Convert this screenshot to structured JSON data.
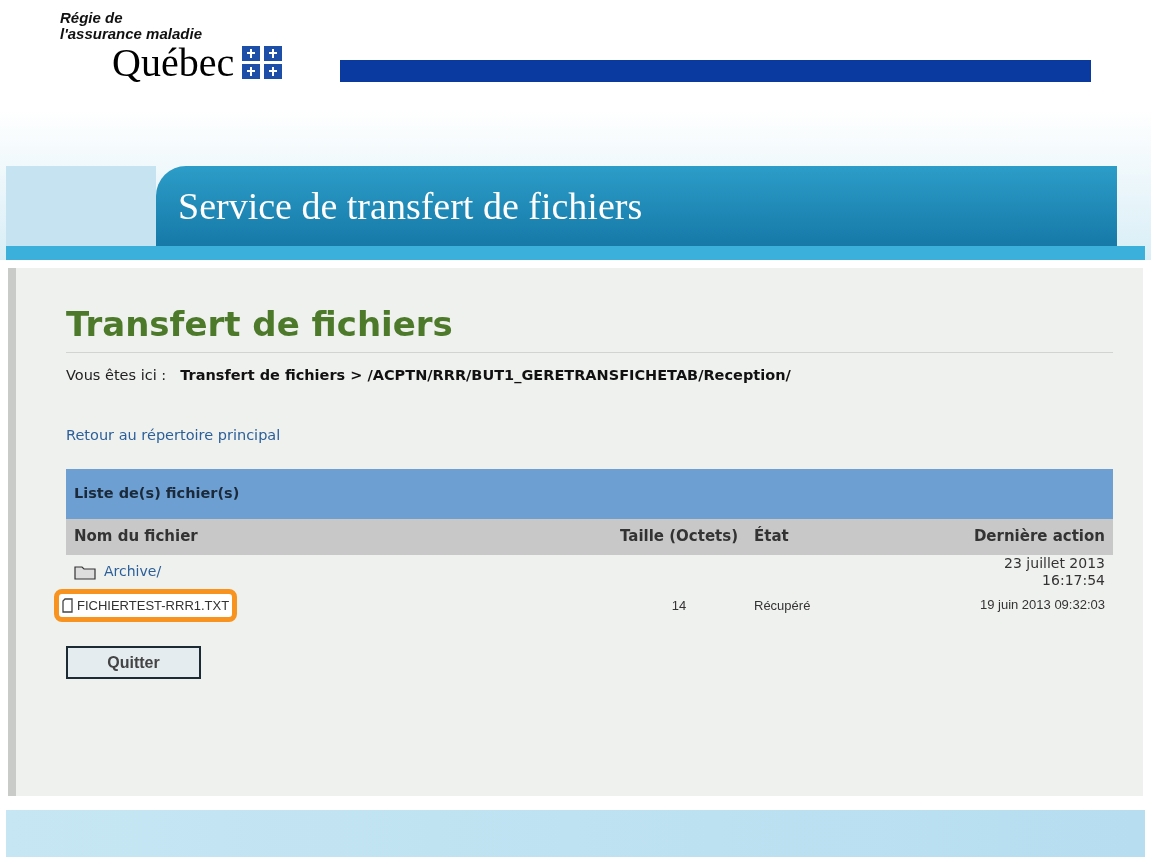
{
  "logo": {
    "line1": "Régie de",
    "line2": "l'assurance maladie",
    "wordmark": "Québec"
  },
  "banner": {
    "title": "Service de transfert de fichiers"
  },
  "page": {
    "heading": "Transfert de fichiers",
    "breadcrumb_label": "Vous êtes ici :",
    "breadcrumb_path": "Transfert de fichiers > /ACPTN/RRR/BUT1_GERETRANSFICHETAB/Reception/",
    "back_link": "Retour au répertoire principal"
  },
  "table": {
    "title": "Liste de(s) fichier(s)",
    "columns": [
      "Nom du fichier",
      "Taille (Octets)",
      "État",
      "Dernière action"
    ],
    "rows": [
      {
        "kind": "folder",
        "name": "Archive/",
        "size": "",
        "state": "",
        "date": [
          "23 juillet 2013",
          "16:17:54"
        ],
        "highlighted": false
      },
      {
        "kind": "file",
        "name": "FICHIERTEST-RRR1.TXT",
        "size": "14",
        "state": "Récupéré",
        "date": [
          "19 juin 2013 09:32:03"
        ],
        "highlighted": true
      }
    ]
  },
  "buttons": [
    "Quitter"
  ]
}
